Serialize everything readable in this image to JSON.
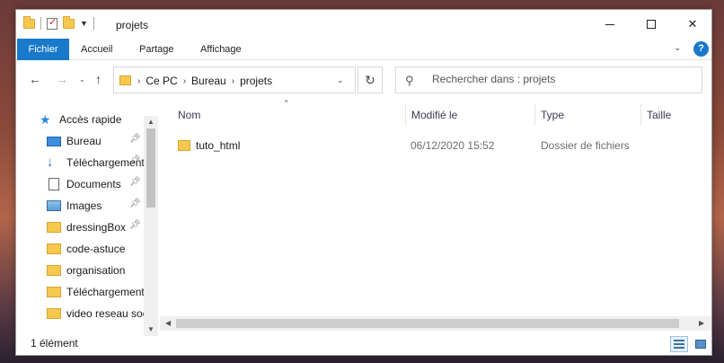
{
  "window": {
    "title": "projets",
    "controls": {
      "minimize": "",
      "maximize": "",
      "close": "✕"
    }
  },
  "ribbon": {
    "tabs": [
      "Fichier",
      "Accueil",
      "Partage",
      "Affichage"
    ],
    "help": "?"
  },
  "nav": {
    "breadcrumb": [
      "Ce PC",
      "Bureau",
      "projets"
    ],
    "search_placeholder": "Rechercher dans : projets"
  },
  "sidebar": {
    "quick_access": "Accès rapide",
    "items": [
      {
        "label": "Bureau",
        "icon": "desktop-icon",
        "pinned": true
      },
      {
        "label": "Téléchargements",
        "icon": "download-icon",
        "pinned": true
      },
      {
        "label": "Documents",
        "icon": "document-icon",
        "pinned": true
      },
      {
        "label": "Images",
        "icon": "image-icon",
        "pinned": true
      },
      {
        "label": "dressingBox",
        "icon": "folder-icon",
        "pinned": true
      },
      {
        "label": "code-astuce",
        "icon": "folder-icon",
        "pinned": false
      },
      {
        "label": "organisation",
        "icon": "folder-icon",
        "pinned": false
      },
      {
        "label": "Téléchargement",
        "icon": "folder-icon",
        "pinned": false
      },
      {
        "label": "video reseau soc",
        "icon": "folder-icon",
        "pinned": false
      }
    ]
  },
  "columns": [
    "Nom",
    "Modifié le",
    "Type",
    "Taille"
  ],
  "files": [
    {
      "name": "tuto_html",
      "modified": "06/12/2020 15:52",
      "type": "Dossier de fichiers",
      "size": ""
    }
  ],
  "status": {
    "count": "1 élément"
  },
  "colors": {
    "accent": "#1979ca",
    "folder": "#f6c94e"
  }
}
